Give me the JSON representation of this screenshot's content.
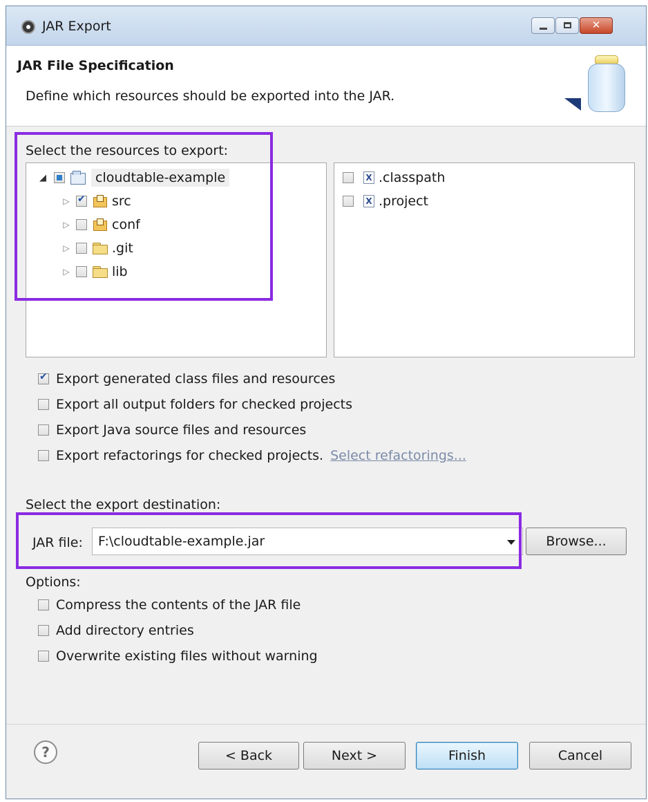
{
  "window": {
    "title": "JAR Export",
    "icon": "eclipse-icon"
  },
  "header": {
    "title": "JAR File Specification",
    "description": "Define which resources should be exported into the JAR.",
    "icon": "jar-icon"
  },
  "resources": {
    "label": "Select the resources to export:",
    "tree": [
      {
        "label": "cloudtable-example",
        "icon": "project-folder-icon",
        "expanded": true,
        "state": "partial"
      },
      {
        "label": "src",
        "icon": "package-folder-icon",
        "expanded": false,
        "state": "checked"
      },
      {
        "label": "conf",
        "icon": "package-folder-icon",
        "expanded": false,
        "state": "unchecked"
      },
      {
        "label": ".git",
        "icon": "folder-icon",
        "expanded": false,
        "state": "unchecked"
      },
      {
        "label": "lib",
        "icon": "folder-icon",
        "expanded": false,
        "state": "unchecked"
      }
    ],
    "files": [
      {
        "label": ".classpath",
        "icon": "xml-file-icon",
        "checked": false
      },
      {
        "label": ".project",
        "icon": "xml-file-icon",
        "checked": false
      }
    ]
  },
  "export_options": [
    {
      "label": "Export generated class files and resources",
      "checked": true
    },
    {
      "label": "Export all output folders for checked projects",
      "checked": false
    },
    {
      "label": "Export Java source files and resources",
      "checked": false
    },
    {
      "label": "Export refactorings for checked projects.",
      "checked": false,
      "link": "Select refactorings..."
    }
  ],
  "destination": {
    "label": "Select the export destination:",
    "jar_label": "JAR file:",
    "jar_value": "F:\\cloudtable-example.jar",
    "browse": "Browse..."
  },
  "options": {
    "label": "Options:",
    "items": [
      {
        "label": "Compress the contents of the JAR file",
        "checked": false
      },
      {
        "label": "Add directory entries",
        "checked": false
      },
      {
        "label": "Overwrite existing files without warning",
        "checked": false
      }
    ]
  },
  "footer": {
    "help_glyph": "?",
    "back": "< Back",
    "next": "Next >",
    "finish": "Finish",
    "cancel": "Cancel"
  },
  "colors": {
    "highlight": "#8a2be2",
    "check": "#2150a6",
    "default_button": "#3c7fb1"
  }
}
